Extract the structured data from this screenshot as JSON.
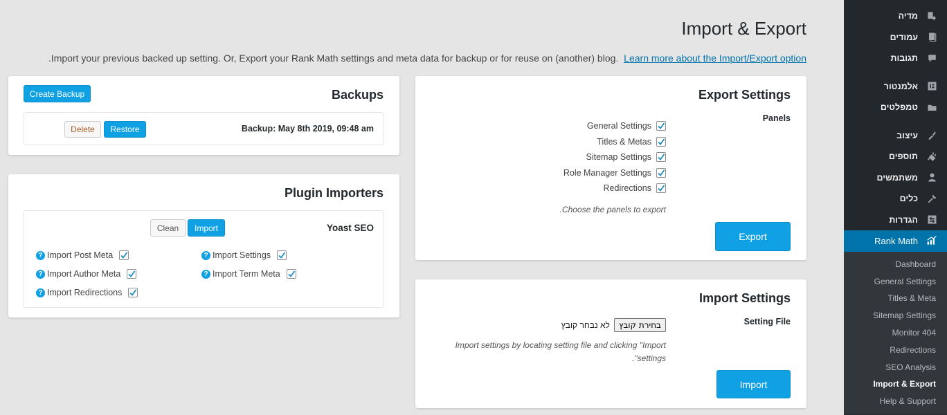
{
  "sidebar": {
    "items": [
      {
        "label": "מדיה",
        "icon": "media-icon"
      },
      {
        "label": "עמודים",
        "icon": "pages-icon"
      },
      {
        "label": "תגובות",
        "icon": "comments-icon"
      },
      {
        "label": "אלמנטור",
        "icon": "elementor-icon"
      },
      {
        "label": "טמפלטים",
        "icon": "templates-icon"
      },
      {
        "label": "עיצוב",
        "icon": "appearance-icon"
      },
      {
        "label": "תוספים",
        "icon": "plugins-icon"
      },
      {
        "label": "משתמשים",
        "icon": "users-icon"
      },
      {
        "label": "כלים",
        "icon": "tools-icon"
      },
      {
        "label": "הגדרות",
        "icon": "settings-icon"
      },
      {
        "label": "Rank Math",
        "icon": "rank-math-icon"
      }
    ],
    "submenu": [
      "Dashboard",
      "General Settings",
      "Titles & Meta",
      "Sitemap Settings",
      "Monitor 404",
      "Redirections",
      "SEO Analysis",
      "Import & Export",
      "Help & Support"
    ]
  },
  "header": {
    "title": "Import & Export",
    "intro": "Import your previous backed up setting. Or, Export your Rank Math settings and meta data for backup or for reuse on (another) blog.",
    "intro_link": "Learn more about the Import/Export option",
    "intro_trailing": "."
  },
  "backups": {
    "title": "Backups",
    "create_label": "Create Backup",
    "backup_label": "Backup: May 8th 2019, 09:48 am",
    "delete_label": "Delete",
    "restore_label": "Restore"
  },
  "plugin_importers": {
    "title": "Plugin Importers",
    "plugin_name": "Yoast SEO",
    "clean_label": "Clean",
    "import_label": "Import",
    "options": [
      "Import Post Meta",
      "Import Settings",
      "Import Author Meta",
      "Import Term Meta",
      "Import Redirections"
    ]
  },
  "export_settings": {
    "title": "Export Settings",
    "panels_label": "Panels",
    "panels": [
      "General Settings",
      "Titles & Metas",
      "Sitemap Settings",
      "Role Manager Settings",
      "Redirections"
    ],
    "hint": ".Choose the panels to export",
    "button_label": "Export"
  },
  "import_settings": {
    "title": "Import Settings",
    "file_label": "Setting File",
    "choose_file_label": "בחירת קובץ",
    "no_file_label": "לא נבחר קובץ",
    "hint_line1": "Import settings by locating setting file and clicking \"Import",
    "hint_line2": ".\"settings",
    "button_label": "Import"
  },
  "colors": {
    "accent": "#10a0e4",
    "sidebar_bg": "#23282d",
    "sidebar_active": "#0073aa"
  }
}
